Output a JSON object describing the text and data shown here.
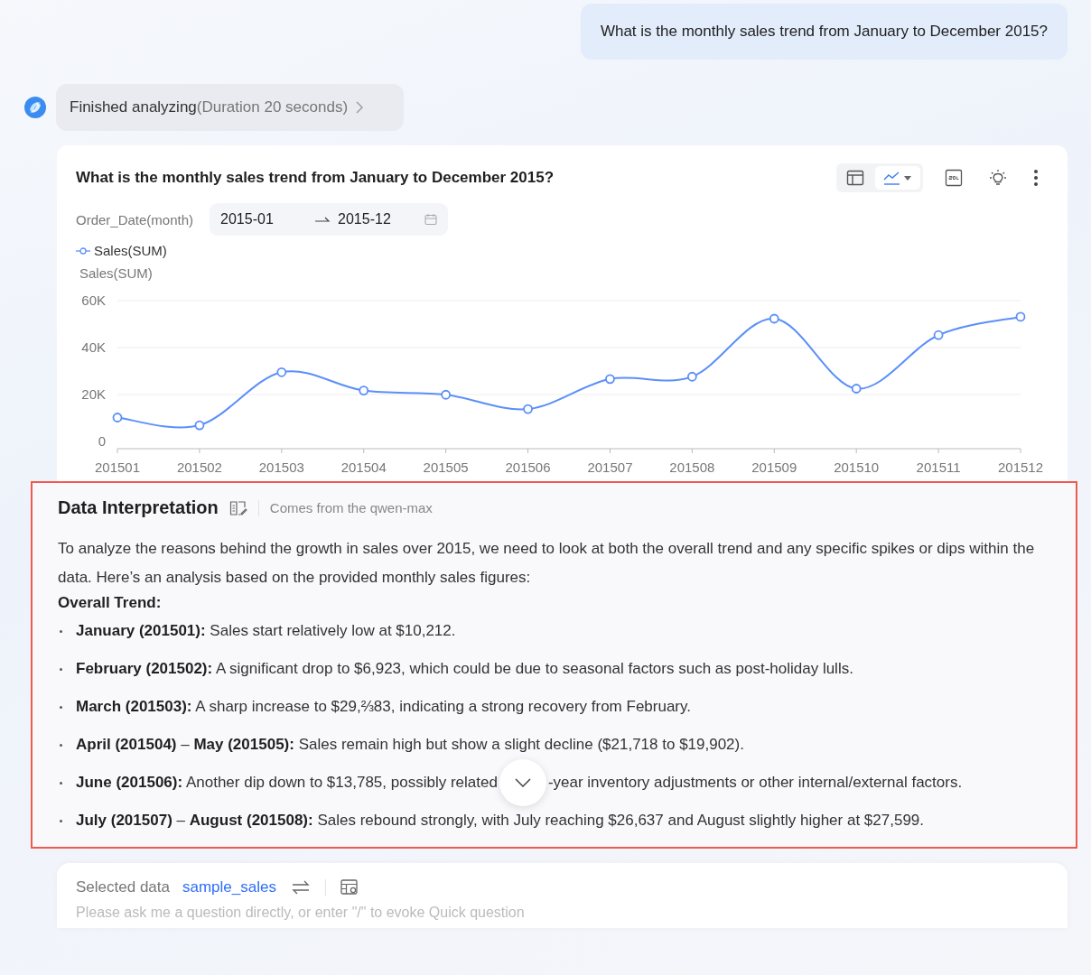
{
  "user_message": "What is the monthly sales trend from January to December 2015?",
  "status": {
    "label": "Finished analyzing",
    "detail": "(Duration 20 seconds)"
  },
  "card": {
    "title": "What is the monthly sales trend from January to December 2015?",
    "view_toggle": [
      {
        "kind": "table",
        "selected": false
      },
      {
        "kind": "line",
        "selected": true
      }
    ],
    "filter": {
      "label": "Order_Date(month)",
      "start": "2015-01",
      "end": "2015-12"
    },
    "chart_data": {
      "type": "line",
      "ylabel": "Sales(SUM)",
      "categories": [
        "201501",
        "201502",
        "201503",
        "201504",
        "201505",
        "201506",
        "201507",
        "201508",
        "201509",
        "201510",
        "201511",
        "201512"
      ],
      "ylim": [
        0,
        60000
      ],
      "yticks": [
        0,
        {
          "value": 20000,
          "label": "20K"
        },
        {
          "value": 40000,
          "label": "40K"
        },
        {
          "value": 60000,
          "label": "60K"
        }
      ],
      "series": [
        {
          "name": "Sales(SUM)",
          "color": "#5b8ff9",
          "marker": true,
          "values": [
            10200,
            6900,
            29500,
            21700,
            19900,
            13800,
            26600,
            27600,
            52300,
            22500,
            45300,
            53100
          ]
        }
      ]
    }
  },
  "interpretation": {
    "title": "Data Interpretation",
    "source": "Comes from the qwen-max",
    "intro": "To analyze the reasons behind the growth in sales over 2015, we need to look at both the overall trend and any specific spikes or dips within the data. Here’s an analysis based on the provided monthly sales figures:",
    "section": "Overall Trend:",
    "items": [
      {
        "text": "**January (201501):** Sales start relatively low at $10,212."
      },
      {
        "text": "**February (201502):** A significant drop to $6,923, which could be due to seasonal factors such as post-holiday lulls."
      },
      {
        "text": "**March (201503):** A sharp increase to $29,⅔83, indicating a strong recovery from February."
      },
      {
        "text": "**April (201504)** – **May (201505):** Sales remain high but show a slight decline ($21,718 to $19,902)."
      },
      {
        "text": "**June (201506):** Another dip down to $13,785, possibly related",
        "continued": "-year inventory adjustments or other internal/external factors."
      },
      {
        "text": "**July (201507)** – **August (201508):** Sales rebound strongly, with July reaching $26,637 and August slightly higher at $27,599."
      }
    ]
  },
  "composer": {
    "label": "Selected data",
    "dataset": "sample_sales",
    "placeholder": "Please ask me a question directly, or enter \"/\" to evoke Quick question"
  }
}
